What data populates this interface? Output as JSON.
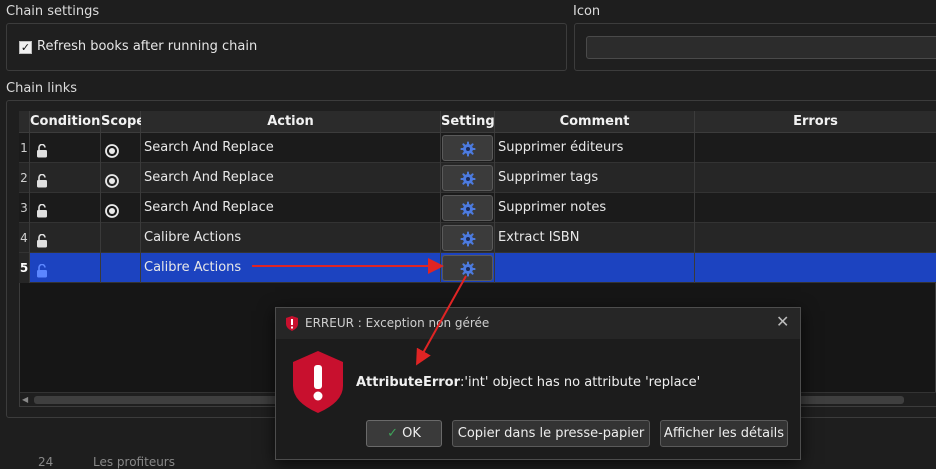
{
  "chain_settings": {
    "label": "Chain settings",
    "refresh_checkbox_label": "Refresh books after running chain",
    "refresh_checked": true
  },
  "icon": {
    "label": "Icon"
  },
  "chain_links": {
    "label": "Chain links",
    "columns": [
      "Conditions",
      "Scope",
      "Action",
      "Settings",
      "Comment",
      "Errors"
    ],
    "rows": [
      {
        "num": "1",
        "scope": true,
        "action": "Search And Replace",
        "comment": "Supprimer éditeurs"
      },
      {
        "num": "2",
        "scope": true,
        "action": "Search And Replace",
        "comment": "Supprimer tags"
      },
      {
        "num": "3",
        "scope": true,
        "action": "Search And Replace",
        "comment": "Supprimer notes"
      },
      {
        "num": "4",
        "scope": false,
        "action": "Calibre Actions",
        "comment": "Extract ISBN"
      },
      {
        "num": "5",
        "scope": false,
        "action": "Calibre Actions",
        "comment": ""
      }
    ],
    "selected_row": 5
  },
  "dialog": {
    "title": "ERREUR : Exception non gérée",
    "error_type": "AttributeError",
    "error_message": ":'int' object has no attribute 'replace'",
    "ok_label": "OK",
    "copy_label": "Copier dans le presse-papier",
    "details_label": "Afficher les détails"
  },
  "bottom_partial": {
    "num": "24",
    "text": "Les profiteurs"
  },
  "colors": {
    "selection": "#1c43c0",
    "arrow": "#e02424",
    "error_shield": "#c8102e",
    "ok_check": "#3fa35a"
  },
  "icons": [
    "checkbox-check-icon",
    "unlocked-padlock-icon",
    "radio-selected-icon",
    "gear-icon",
    "error-shield-icon",
    "close-icon",
    "checkmark-icon"
  ]
}
